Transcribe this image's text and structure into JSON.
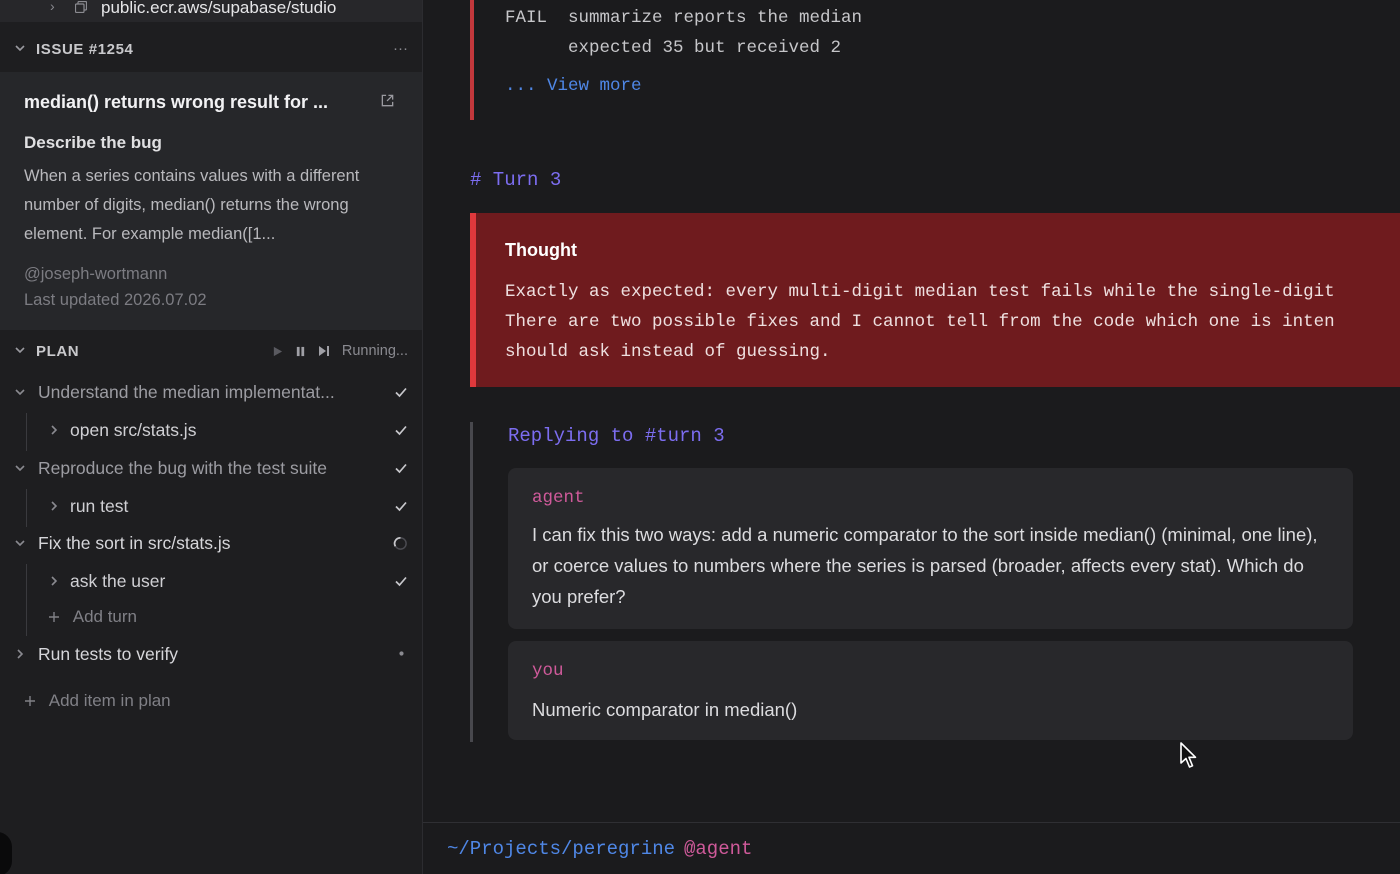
{
  "sidebar": {
    "top_item": {
      "label": "public.ecr.aws/supabase/studio"
    },
    "issue": {
      "section_title": "ISSUE #1254",
      "more_label": "···",
      "title": "median() returns wrong result for ...",
      "desc_heading": "Describe the bug",
      "desc_text": "When a series contains values with a different number of digits, median() returns the wrong element. For example median([1...",
      "author": "@joseph-wortmann",
      "updated": "Last updated 2026.07.02"
    },
    "plan": {
      "section_title": "PLAN",
      "status_text": "Running...",
      "items": [
        {
          "label": "Understand the median implementat...",
          "status": "done"
        },
        {
          "label": "open src/stats.js",
          "status": "done"
        },
        {
          "label": "Reproduce the bug with the test suite",
          "status": "done"
        },
        {
          "label": "run test",
          "status": "done"
        },
        {
          "label": "Fix the sort in src/stats.js",
          "status": "running"
        },
        {
          "label": "ask the user",
          "status": "done"
        },
        {
          "label": "Run tests to verify",
          "status": "pending"
        }
      ],
      "add_turn_label": "Add turn",
      "add_item_label": "Add item in plan"
    }
  },
  "main": {
    "fail_line_1": "FAIL  summarize reports the median",
    "fail_line_2": "      expected 35 but received 2",
    "view_more": "... View more",
    "turn_header": "# Turn 3",
    "thought": {
      "title": "Thought",
      "line_1": "Exactly as expected: every multi-digit median test fails while the single-digit",
      "line_2": "There are two possible fixes and I cannot tell from the code which one is inten",
      "line_3": "should ask instead of guessing."
    },
    "reply": {
      "header": "Replying to #turn 3",
      "agent_name": "agent",
      "agent_text": "I can fix this two ways: add a numeric comparator to the sort inside median() (minimal, one line), or coerce values to numbers where the series is parsed (broader, affects every stat). Which do you prefer?",
      "user_name": "you",
      "user_text": "Numeric comparator in median()"
    },
    "prompt": {
      "path": "~/Projects/peregrine",
      "agent": "@agent"
    }
  },
  "colors": {
    "accent_purple": "#7c6df0",
    "link_blue": "#4f87e6",
    "name_pink": "#cf5a9a",
    "thought_bg": "#6f1b1e",
    "fail_red": "#c2383c"
  },
  "icons": [
    "chevron-right-icon",
    "copy-icon",
    "chevron-down-icon",
    "external-link-icon",
    "play-icon",
    "pause-icon",
    "step-forward-icon",
    "check-icon",
    "spinner-icon",
    "dot-icon",
    "plus-icon",
    "cursor-icon"
  ]
}
